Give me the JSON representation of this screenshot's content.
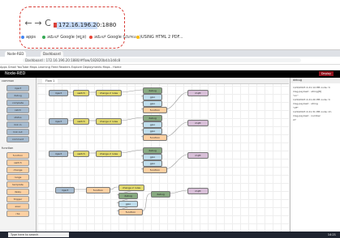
{
  "browser": {
    "back": "←",
    "forward": "→",
    "reload": "C",
    "url": "172.16.196.20:1880",
    "bookmarks": [
      {
        "label": "apps",
        "color": "#4285f4"
      },
      {
        "label": "ಜಿಮೇಲ್ Google (ಕನ್ನಡ)",
        "color": "#34a853"
      },
      {
        "label": "ಜಿಮೇಲ್ Google (ಬೆಂಗಳೂರು)",
        "color": "#ea4335"
      },
      {
        "label": "USING HTML 2 PDF...",
        "color": "#fbbc05"
      }
    ]
  },
  "inner": {
    "tabs": [
      "Node-RED",
      "Dashboard",
      "172.16.196.20:1880"
    ],
    "address": "Dashboard : 172.16.196.20:1880/#flow/182820bd.b1d4c8",
    "bookmarks_text": "Apps  Gmail  YouTube  Maps  Learning  Feed Readers  Explore  Deployments  Maps - Home",
    "header_title": "Node-RED",
    "deploy_label": "Deploy",
    "palette_sections": [
      {
        "title": "common",
        "nodes": [
          "inject",
          "debug",
          "complete",
          "catch",
          "status",
          "link in",
          "link out",
          "comment"
        ],
        "color": "#a6bbcf"
      },
      {
        "title": "function",
        "nodes": [
          "function",
          "switch",
          "change",
          "range",
          "template",
          "delay",
          "trigger",
          "exec",
          "rbe"
        ],
        "color": "#fdd0a2"
      }
    ],
    "workspace_tab": "Flow 1",
    "sidebar_title": "debug",
    "sidebar_lines": [
      "1/29/2023 2:21:14 PM node: ti",
      "msg.payload : string[8]",
      "\"on\"",
      "1/29/2023 2:21:20 PM node: ti",
      "msg.payload : string",
      "\"off\"",
      "1/29/2023 2:21:31 PM node: lm",
      "msg.payload : number",
      "27"
    ],
    "flow_nodes": [
      {
        "label": "switch",
        "color": "#e2d96e"
      },
      {
        "label": "change 2 rules",
        "color": "#e2d96e"
      },
      {
        "label": "function",
        "color": "#fdd0a2"
      },
      {
        "label": "debug",
        "color": "#87a980"
      },
      {
        "label": "gpio",
        "color": "#c0deed"
      },
      {
        "label": "mqtt",
        "color": "#d8bfd8"
      },
      {
        "label": "inject",
        "color": "#a6bbcf"
      }
    ]
  },
  "taskbar": {
    "search_placeholder": "Type here to search",
    "time": "14:21"
  }
}
